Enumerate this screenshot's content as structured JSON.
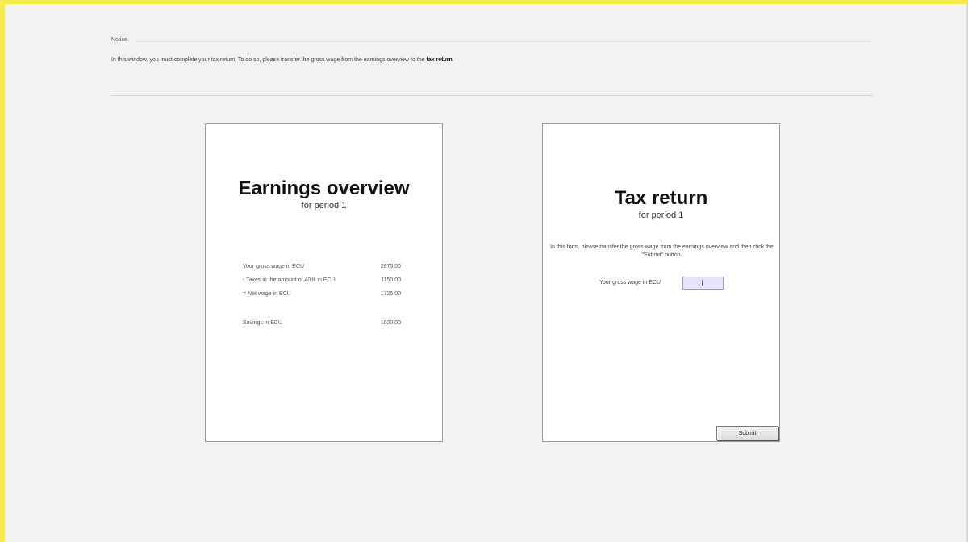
{
  "notice": {
    "label": "Notice",
    "text_before": "In this window, you must complete your tax return. To do so, please transfer the gross wage from the earnings overview to the ",
    "text_bold": "tax return",
    "text_after": "."
  },
  "earnings": {
    "title": "Earnings overview",
    "subtitle": "for period 1",
    "rows": [
      {
        "label": "Your gross wage in ECU",
        "value": "2875.00"
      },
      {
        "label": "- Taxes in the amount of 40% in ECU",
        "value": "1150.00"
      },
      {
        "label": "= Net wage in ECU",
        "value": "1725.00"
      },
      {
        "label": "Savings in ECU",
        "value": "1020.00"
      }
    ]
  },
  "tax": {
    "title": "Tax return",
    "subtitle": "for period 1",
    "instruction": "In this form, please transfer the gross wage from the earnings overview and then click the \"Submit\" button.",
    "field_label": "Your gross wage in ECU",
    "field_value": "",
    "submit_label": "Submit"
  }
}
